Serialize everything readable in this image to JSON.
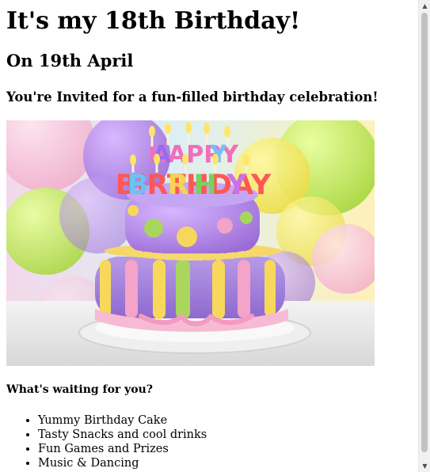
{
  "heading": "It's my 18th Birthday!",
  "date": "On 19th April",
  "invite": "You're Invited for a fun-filled birthday celebration!",
  "image": {
    "candle_text": "HAPPY BIRTHDAY"
  },
  "waiting_heading": "What's waiting for you?",
  "list_items": [
    "Yummy Birthday Cake",
    "Tasty Snacks and cool drinks",
    "Fun Games and Prizes",
    "Music & Dancing"
  ],
  "scrollbar": {
    "up_icon": "triangle-up",
    "down_icon": "triangle-down"
  }
}
